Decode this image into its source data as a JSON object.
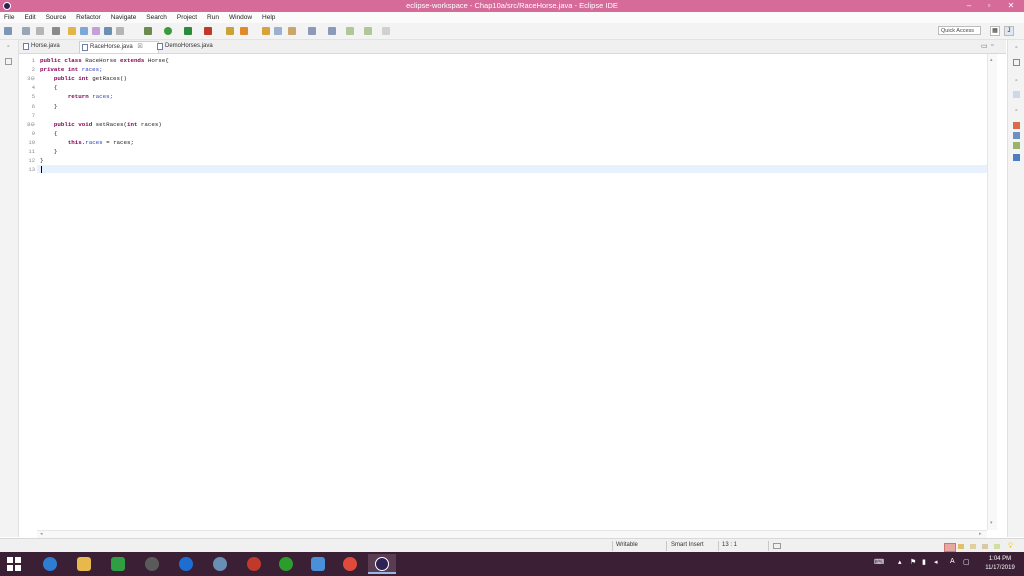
{
  "window": {
    "title": "eclipse-workspace - Chap10a/src/RaceHorse.java - Eclipse IDE",
    "minimize_glyph": "–",
    "maximize_glyph": "▫",
    "close_glyph": "✕"
  },
  "menu": [
    "File",
    "Edit",
    "Source",
    "Refactor",
    "Navigate",
    "Search",
    "Project",
    "Run",
    "Window",
    "Help"
  ],
  "toolbar": {
    "quick_access": "Quick Access",
    "icons": [
      "new-icon",
      "save-icon",
      "print-icon",
      "open-type-icon",
      "debug-icon",
      "run-icon",
      "coverage-icon",
      "external-tools-icon",
      "search-icon",
      "back-icon",
      "forward-icon"
    ]
  },
  "tabs": [
    {
      "label": "Horse.java",
      "active": false
    },
    {
      "label": "RaceHorse.java",
      "close": "☒",
      "active": true
    },
    {
      "label": "DemoHorses.java",
      "active": false
    }
  ],
  "editor": {
    "line_numbers": [
      "1",
      "2",
      "3⊖",
      "4",
      "5",
      "6",
      "7",
      "8⊖",
      "9",
      "10",
      "11",
      "12",
      "13"
    ],
    "lines": [
      [
        {
          "t": "public class ",
          "c": "kw"
        },
        {
          "t": "RaceHorse ",
          "c": ""
        },
        {
          "t": "extends ",
          "c": "kw"
        },
        {
          "t": "Horse{",
          "c": ""
        }
      ],
      [
        {
          "t": "private int ",
          "c": "kw"
        },
        {
          "t": "races;",
          "c": "fld"
        }
      ],
      [
        {
          "t": "    public int ",
          "c": "kw"
        },
        {
          "t": "getRaces()",
          "c": ""
        }
      ],
      [
        {
          "t": "    {",
          "c": ""
        }
      ],
      [
        {
          "t": "        return ",
          "c": "kw"
        },
        {
          "t": "races;",
          "c": "fld"
        }
      ],
      [
        {
          "t": "    }",
          "c": ""
        }
      ],
      [
        {
          "t": "",
          "c": ""
        }
      ],
      [
        {
          "t": "    public void ",
          "c": "kw"
        },
        {
          "t": "setRaces(",
          "c": ""
        },
        {
          "t": "int ",
          "c": "kw"
        },
        {
          "t": "races)",
          "c": ""
        }
      ],
      [
        {
          "t": "    {",
          "c": ""
        }
      ],
      [
        {
          "t": "        this.",
          "c": "kw"
        },
        {
          "t": "races",
          "c": "fld"
        },
        {
          "t": " = races;",
          "c": ""
        }
      ],
      [
        {
          "t": "    }",
          "c": ""
        }
      ],
      [
        {
          "t": "}",
          "c": ""
        }
      ],
      [
        {
          "t": "",
          "c": ""
        }
      ]
    ]
  },
  "status": {
    "writable": "Writable",
    "insert_mode": "Smart Insert",
    "position": "13 : 1"
  },
  "taskbar": {
    "apps": [
      "start-icon",
      "edge-icon",
      "file-explorer-icon",
      "store-icon",
      "app-icon",
      "media-icon",
      "camera-icon",
      "recorder-icon",
      "music-icon",
      "network-icon",
      "chrome-icon",
      "eclipse-icon"
    ],
    "time": "1:04 PM",
    "date": "11/17/2019",
    "lang": "A"
  },
  "colors": {
    "titlebar": "#d66b9a",
    "taskbar": "#3b1f35",
    "current_line": "#e8f2fe",
    "keyword": "#8b0057",
    "field": "#2a3fc6"
  }
}
